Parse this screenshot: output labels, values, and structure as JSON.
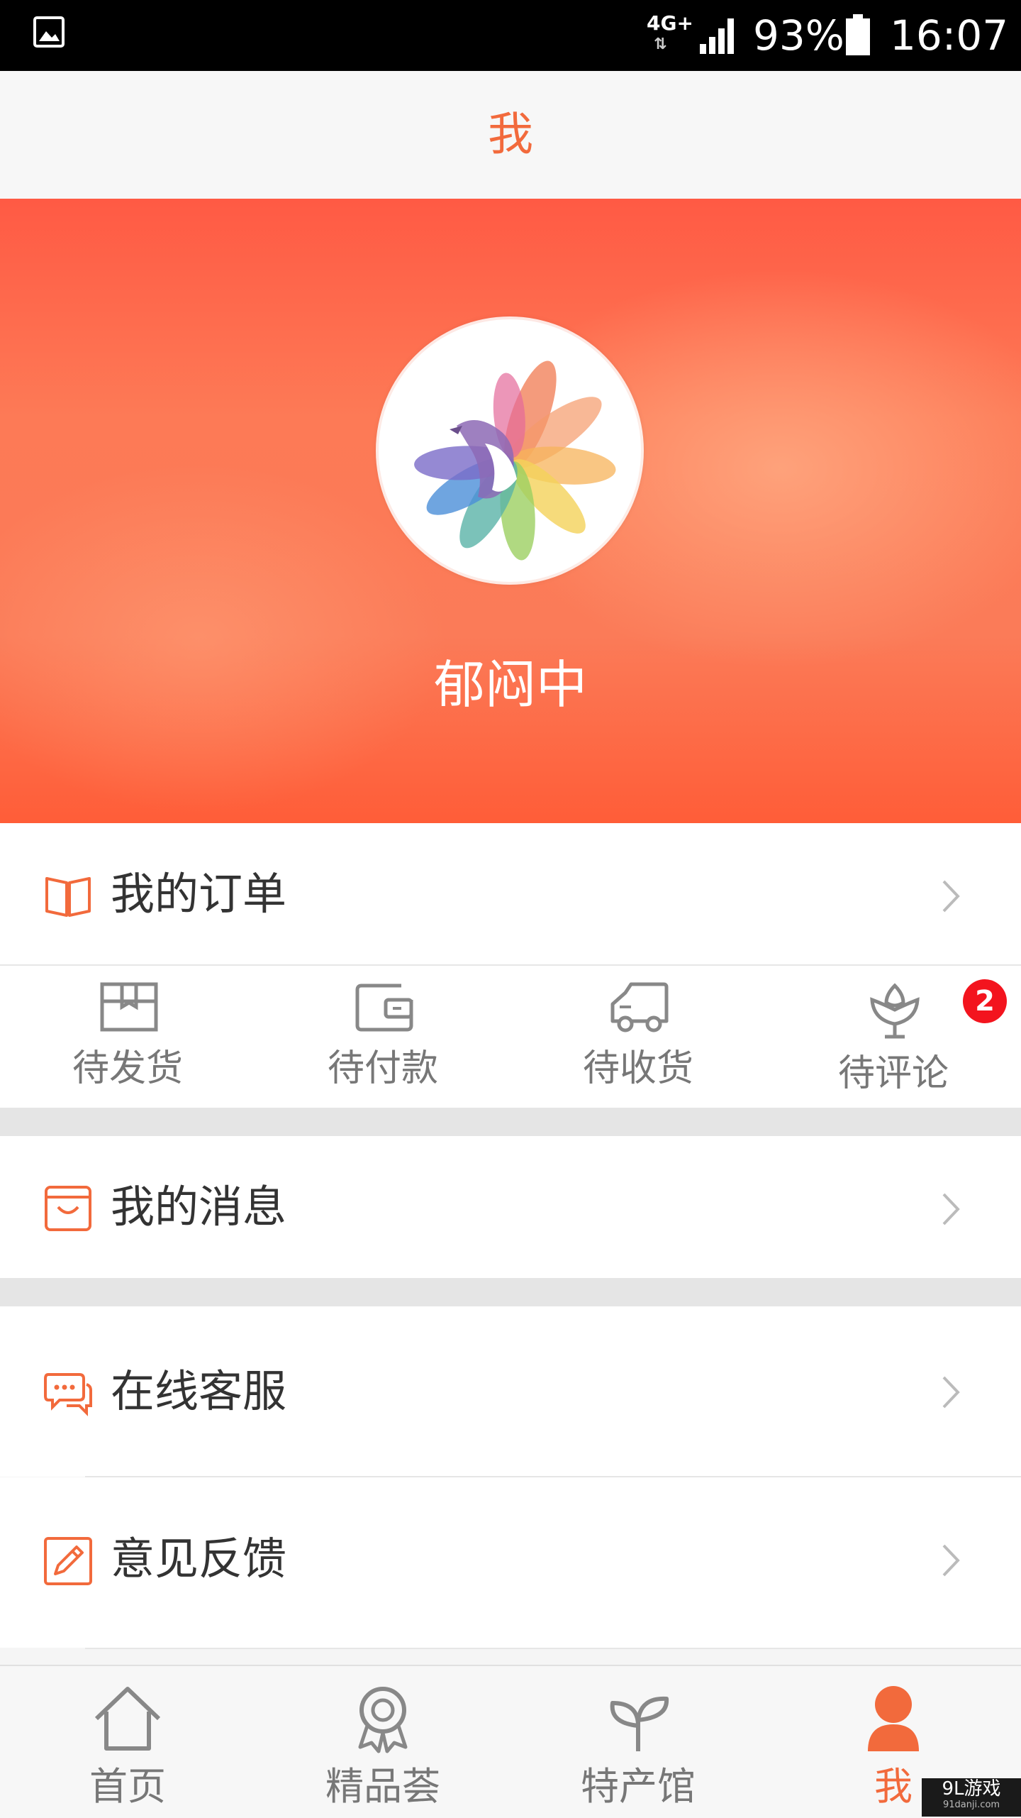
{
  "status_bar": {
    "network": "4G+",
    "battery_percent": "93%",
    "time": "16:07"
  },
  "header": {
    "title": "我"
  },
  "profile": {
    "username": "郁闷中"
  },
  "orders": {
    "label": "我的订单",
    "status_items": [
      {
        "label": "待发货",
        "icon": "box-icon"
      },
      {
        "label": "待付款",
        "icon": "wallet-icon"
      },
      {
        "label": "待收货",
        "icon": "truck-icon"
      },
      {
        "label": "待评论",
        "icon": "flower-icon",
        "badge": "2"
      }
    ]
  },
  "menu": {
    "messages": "我的消息",
    "customer_service": "在线客服",
    "feedback": "意见反馈"
  },
  "tab_bar": {
    "items": [
      {
        "label": "首页",
        "icon": "home-icon"
      },
      {
        "label": "精品荟",
        "icon": "award-icon"
      },
      {
        "label": "特产馆",
        "icon": "sprout-icon"
      },
      {
        "label": "我",
        "icon": "user-icon",
        "active": true
      }
    ]
  },
  "watermark": {
    "brand": "9L游戏",
    "url": "91danji.com"
  },
  "colors": {
    "accent": "#f26a3c",
    "badge": "#f3141e",
    "hero_top": "#ff5a44",
    "hero_bottom": "#ff5d38"
  }
}
